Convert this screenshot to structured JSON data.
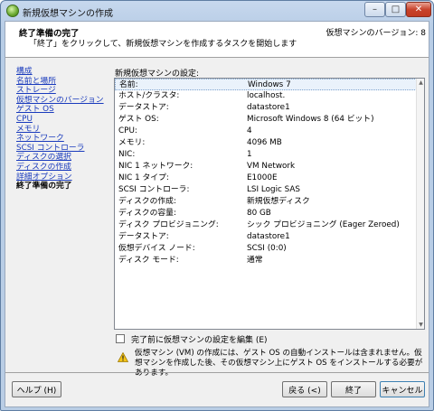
{
  "window": {
    "title": "新規仮想マシンの作成",
    "controls": {
      "minimize": "–",
      "maximize": "□",
      "close": "✕"
    }
  },
  "header": {
    "title": "終了準備の完了",
    "description": "「終了」をクリックして、新規仮想マシンを作成するタスクを開始します",
    "version": "仮想マシンのバージョン: 8"
  },
  "nav": {
    "items": [
      {
        "label": "構成",
        "current": false
      },
      {
        "label": "名前と場所",
        "current": false
      },
      {
        "label": "ストレージ",
        "current": false
      },
      {
        "label": "仮想マシンのバージョン",
        "current": false
      },
      {
        "label": "ゲスト OS",
        "current": false
      },
      {
        "label": "CPU",
        "current": false
      },
      {
        "label": "メモリ",
        "current": false
      },
      {
        "label": "ネットワーク",
        "current": false
      },
      {
        "label": "SCSI コントローラ",
        "current": false
      },
      {
        "label": "ディスクの選択",
        "current": false
      },
      {
        "label": "ディスクの作成",
        "current": false
      },
      {
        "label": "詳細オプション",
        "current": false
      },
      {
        "label": "終了準備の完了",
        "current": true
      }
    ]
  },
  "settings": {
    "label": "新規仮想マシンの設定:",
    "rows": [
      {
        "key": "名前:",
        "value": "Windows 7"
      },
      {
        "key": "ホスト/クラスタ:",
        "value": "localhost."
      },
      {
        "key": "データストア:",
        "value": "datastore1"
      },
      {
        "key": "ゲスト OS:",
        "value": "Microsoft Windows 8 (64 ビット)"
      },
      {
        "key": "CPU:",
        "value": "4"
      },
      {
        "key": "メモリ:",
        "value": "4096 MB"
      },
      {
        "key": "NIC:",
        "value": "1"
      },
      {
        "key": "NIC 1 ネットワーク:",
        "value": "VM Network"
      },
      {
        "key": "NIC 1 タイプ:",
        "value": "E1000E"
      },
      {
        "key": "SCSI コントローラ:",
        "value": "LSI Logic SAS"
      },
      {
        "key": "ディスクの作成:",
        "value": "新規仮想ディスク"
      },
      {
        "key": "ディスクの容量:",
        "value": "80 GB"
      },
      {
        "key": "ディスク プロビジョニング:",
        "value": "シック プロビジョニング (Eager Zeroed)"
      },
      {
        "key": "データストア:",
        "value": "datastore1"
      },
      {
        "key": "仮想デバイス ノード:",
        "value": "SCSI (0:0)"
      },
      {
        "key": "ディスク モード:",
        "value": "通常"
      }
    ]
  },
  "edit_checkbox": {
    "label": "完了前に仮想マシンの設定を編集 (E)",
    "checked": false
  },
  "warning": {
    "icon": "warning-icon",
    "text": "仮想マシン (VM) の作成には、ゲスト OS の自動インストールは含まれません。仮想マシンを作成した後、その仮想マシン上にゲスト OS をインストールする必要があります。"
  },
  "buttons": {
    "help": "ヘルプ (H)",
    "back": "戻る (<)",
    "finish": "終了",
    "cancel": "キャンセル"
  },
  "colors": {
    "link": "#1a3bbd",
    "selection": "#eaf2fb",
    "close_button": "#c8432c",
    "warning": "#f5c518"
  }
}
